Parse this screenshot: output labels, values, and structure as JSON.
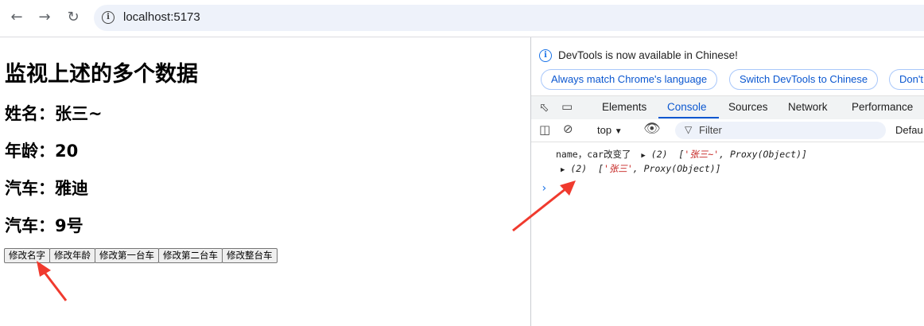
{
  "browser": {
    "url": "localhost:5173",
    "back_icon": "arrow-left-icon",
    "forward_icon": "arrow-right-icon",
    "reload_icon": "reload-icon",
    "site_info_icon": "info-icon"
  },
  "page": {
    "heading": "监视上述的多个数据",
    "lines": [
      "姓名：张三~",
      "年龄：20",
      "汽车：雅迪",
      "汽车：9号"
    ],
    "buttons": [
      "修改名字",
      "修改年龄",
      "修改第一台车",
      "修改第二台车",
      "修改整台车"
    ]
  },
  "devtools": {
    "banner": "DevTools is now available in Chinese!",
    "banner_buttons": [
      "Always match Chrome's language",
      "Switch DevTools to Chinese",
      "Don't"
    ],
    "tabs": [
      "Elements",
      "Console",
      "Sources",
      "Network",
      "Performance"
    ],
    "active_tab": "Console",
    "context_selector": "top",
    "filter_placeholder": "Filter",
    "levels_label": "Defau",
    "console_lines": [
      {
        "prefix": "name，car改变了",
        "count": "(2)",
        "str": "'张三~'",
        "rest": "Proxy(Object)"
      },
      {
        "prefix": "",
        "count": "(2)",
        "str": "'张三'",
        "rest": "Proxy(Object)"
      }
    ]
  },
  "colors": {
    "accent": "#0b57d0",
    "annotation_arrow": "#f03a2e",
    "string_red": "#c5221f"
  }
}
